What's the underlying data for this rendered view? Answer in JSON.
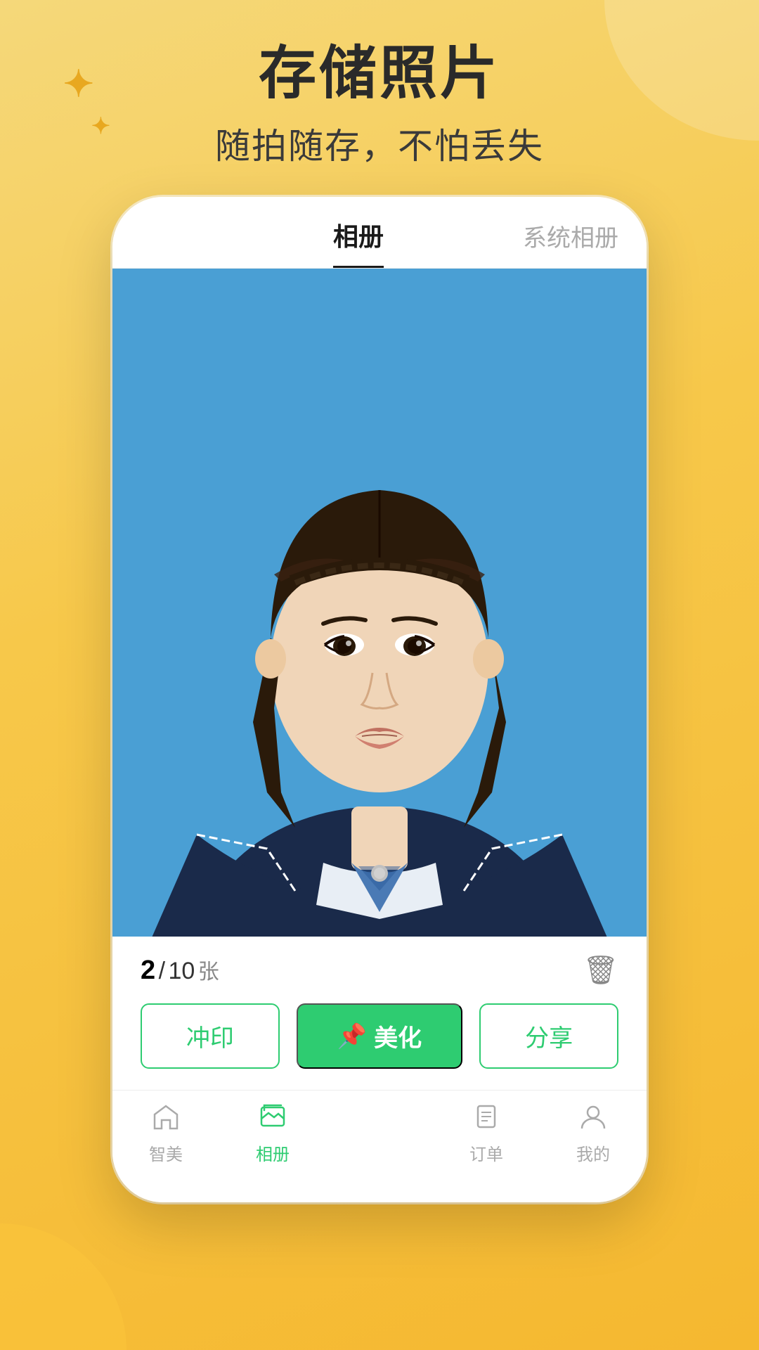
{
  "page": {
    "background_color": "#f5c842",
    "title": "存储照片",
    "subtitle": "随拍随存，不怕丢失"
  },
  "phone": {
    "header": {
      "tab_active": "相册",
      "tab_inactive": "系统相册"
    },
    "photo": {
      "count_current": "2",
      "count_separator": "/",
      "count_total": "10",
      "count_unit": "张"
    },
    "buttons": {
      "print": "冲印",
      "beautify": "美化",
      "share": "分享",
      "pin_icon": "📌"
    },
    "nav": {
      "items": [
        {
          "id": "home",
          "label": "智美",
          "active": false
        },
        {
          "id": "album",
          "label": "相册",
          "active": true
        },
        {
          "id": "camera",
          "label": "",
          "active": false,
          "is_fab": true
        },
        {
          "id": "orders",
          "label": "订单",
          "active": false
        },
        {
          "id": "mine",
          "label": "我的",
          "active": false
        }
      ]
    }
  },
  "sparkles": {
    "icon": "✦"
  }
}
